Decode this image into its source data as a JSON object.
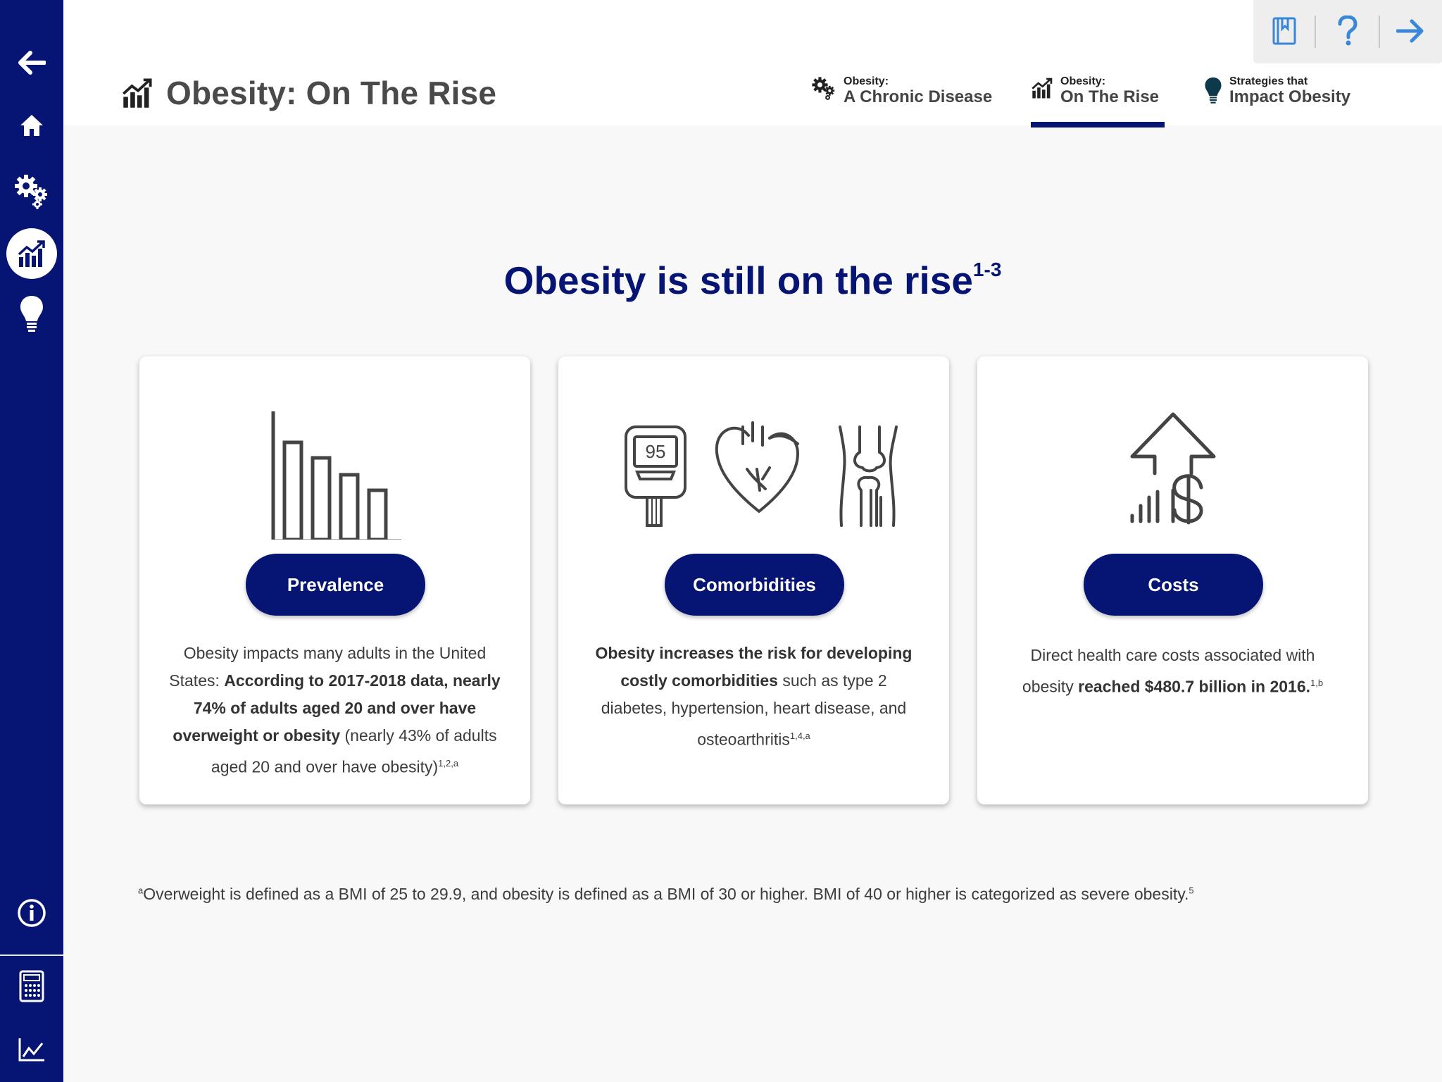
{
  "sidebar": {
    "items": [
      {
        "icon": "back-arrow-icon"
      },
      {
        "icon": "home-icon"
      },
      {
        "icon": "gears-icon"
      },
      {
        "icon": "chart-rising-icon",
        "active": true
      },
      {
        "icon": "lightbulb-icon"
      },
      {
        "icon": "info-icon"
      },
      {
        "icon": "calculator-icon"
      },
      {
        "icon": "line-graph-icon"
      }
    ]
  },
  "header": {
    "title": "Obesity: On The Rise",
    "toolbar": {
      "icons": [
        "bookmark-icon",
        "help-icon",
        "next-arrow-icon"
      ],
      "accent": "#3a87d8"
    },
    "tabs": [
      {
        "small": "Obesity:",
        "big": "A Chronic Disease",
        "icon": "gears-icon"
      },
      {
        "small": "Obesity:",
        "big": "On The Rise",
        "icon": "chart-rising-icon",
        "active": true
      },
      {
        "small": "Strategies that",
        "big": "Impact Obesity",
        "icon": "lightbulb-icon"
      }
    ]
  },
  "main": {
    "headline": "Obesity is still on the rise",
    "headline_ref": "1-3",
    "cards": [
      {
        "button": "Prevalence",
        "text_1": "Obesity impacts many adults in the United States: ",
        "bold_1": "According to 2017-2018 data, nearly 74% of adults aged 20 and over have overweight or obesity",
        "text_2": " (nearly 43% of adults aged 20 and over have obesity)",
        "ref": "1,2,a"
      },
      {
        "button": "Comorbidities",
        "bold_1": "Obesity increases the risk for developing costly comorbidities",
        "text_1": " such as type 2 diabetes, hypertension, heart disease, and osteoarthritis",
        "ref": "1,4,a",
        "meter_value": "95"
      },
      {
        "button": "Costs",
        "text_1": "Direct health care costs associated with obesity ",
        "bold_1": "reached $480.7 billion in 2016.",
        "ref": "1,b"
      }
    ],
    "footnote_mark": "a",
    "footnote": "Overweight is defined as a BMI of 25 to 29.9, and obesity is defined as a BMI of 30 or higher. BMI of 40 or higher is categorized as severe obesity.",
    "footnote_ref": "5"
  },
  "colors": {
    "navy": "#061574",
    "background": "#f8f8f8",
    "text": "#3c3c3c"
  }
}
